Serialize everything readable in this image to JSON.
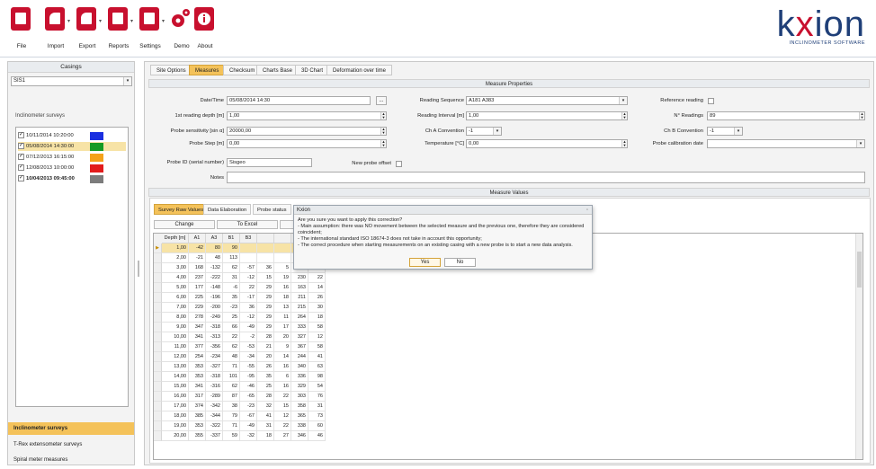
{
  "toolbar": {
    "buttons": [
      {
        "label": "File",
        "icon": "file-icon"
      },
      {
        "label": "Import",
        "icon": "import-icon"
      },
      {
        "label": "Export",
        "icon": "export-icon"
      },
      {
        "label": "Reports",
        "icon": "reports-icon"
      },
      {
        "label": "Settings",
        "icon": "settings-icon"
      },
      {
        "label": "Demo",
        "icon": "demo-icon"
      },
      {
        "label": "About",
        "icon": "about-icon"
      }
    ]
  },
  "logo": {
    "text_k": "k",
    "text_x": "x",
    "text_ion": "ion",
    "subtitle": "INCLINOMETER SOFTWARE"
  },
  "left": {
    "casings_title": "Casings",
    "casing_value": "SIS1",
    "surveys_title": "Inclinometer surveys",
    "surveys": [
      {
        "label": "10/11/2014 10:20:00",
        "color": "#1a2fe0",
        "checked": true
      },
      {
        "label": "05/08/2014 14:30:00",
        "color": "#159a24",
        "checked": true
      },
      {
        "label": "07/12/2013 16:15:00",
        "color": "#f4a21a",
        "checked": true
      },
      {
        "label": "12/08/2013 10:00:00",
        "color": "#e21b1b",
        "checked": true
      },
      {
        "label": "10/04/2013 09:45:00",
        "color": "#7c7c7c",
        "checked": true
      }
    ],
    "nav": [
      {
        "label": "Inclinometer surveys",
        "active": true
      },
      {
        "label": "T-Rex extensometer surveys",
        "active": false
      },
      {
        "label": "Spiral meter measures",
        "active": false
      }
    ]
  },
  "tabs": [
    "Site Options",
    "Measures",
    "Checksum",
    "Charts Base",
    "3D Chart",
    "Deformation over time"
  ],
  "measure_properties": {
    "title": "Measure Properties",
    "datetime_label": "Date/Time",
    "datetime_value": "05/08/2014 14:30",
    "datetime_btn": "...",
    "first_depth_label": "1st reading depth [m]",
    "first_depth_value": "1,00",
    "sensitivity_label": "Probe sensitivity [sin α]",
    "sensitivity_value": "20000,00",
    "step_label": "Probe Step [m]",
    "step_value": "0,00",
    "reading_seq_label": "Reading Sequence",
    "reading_seq_value": "A181 A383",
    "reading_interval_label": "Reading Interval [m]",
    "reading_interval_value": "1,00",
    "cha_label": "Ch A Convention",
    "cha_value": "-1",
    "temp_label": "Temperature [°C]",
    "temp_value": "0,00",
    "reference_label": "Reference reading",
    "nreadings_label": "N° Readings",
    "nreadings_value": "89",
    "chb_label": "Ch B Convention",
    "chb_value": "-1",
    "calib_label": "Probe calibration date",
    "probe_id_label": "Probe ID (serial number)",
    "probe_id_value": "Sisgeo",
    "new_offset_label": "New probe offset",
    "notes_label": "Notes"
  },
  "measure_values": {
    "title": "Measure Values",
    "inner_tabs": [
      "Survey Raw Values",
      "Data Elaboration",
      "Probe status"
    ],
    "change_btn": "Change",
    "excel_btn": "To Excel",
    "columns": [
      "Depth [m]",
      "A1 [digit]",
      "A3 [digit]",
      "B1 [digit]",
      "B3 [digit]",
      "",
      "",
      "",
      ""
    ],
    "rows": [
      [
        "1,00",
        "-42",
        "80",
        "90",
        "",
        "",
        "",
        "",
        ""
      ],
      [
        "2,00",
        "-21",
        "48",
        "113",
        "",
        "",
        "",
        "",
        ""
      ],
      [
        "3,00",
        "168",
        "-132",
        "62",
        "-57",
        "36",
        "5",
        "150",
        "60"
      ],
      [
        "4,00",
        "237",
        "-222",
        "31",
        "-12",
        "15",
        "19",
        "230",
        "22"
      ],
      [
        "5,00",
        "177",
        "-148",
        "-6",
        "22",
        "29",
        "16",
        "163",
        "14"
      ],
      [
        "6,00",
        "225",
        "-196",
        "35",
        "-17",
        "29",
        "18",
        "211",
        "26"
      ],
      [
        "7,00",
        "229",
        "-200",
        "-23",
        "36",
        "29",
        "13",
        "215",
        "30"
      ],
      [
        "8,00",
        "278",
        "-249",
        "25",
        "-12",
        "29",
        "11",
        "264",
        "18"
      ],
      [
        "9,00",
        "347",
        "-318",
        "66",
        "-49",
        "29",
        "17",
        "333",
        "58"
      ],
      [
        "10,00",
        "341",
        "-313",
        "22",
        "-2",
        "28",
        "20",
        "327",
        "12"
      ],
      [
        "11,00",
        "377",
        "-356",
        "62",
        "-53",
        "21",
        "9",
        "367",
        "58"
      ],
      [
        "12,00",
        "254",
        "-234",
        "48",
        "-34",
        "20",
        "14",
        "244",
        "41"
      ],
      [
        "13,00",
        "353",
        "-327",
        "71",
        "-55",
        "26",
        "16",
        "340",
        "63"
      ],
      [
        "14,00",
        "353",
        "-318",
        "101",
        "-95",
        "35",
        "6",
        "336",
        "98"
      ],
      [
        "15,00",
        "341",
        "-316",
        "62",
        "-46",
        "25",
        "16",
        "329",
        "54"
      ],
      [
        "16,00",
        "317",
        "-289",
        "87",
        "-65",
        "28",
        "22",
        "303",
        "76"
      ],
      [
        "17,00",
        "374",
        "-342",
        "38",
        "-23",
        "32",
        "15",
        "358",
        "31"
      ],
      [
        "18,00",
        "385",
        "-344",
        "79",
        "-67",
        "41",
        "12",
        "365",
        "73"
      ],
      [
        "19,00",
        "353",
        "-322",
        "71",
        "-49",
        "31",
        "22",
        "338",
        "60"
      ],
      [
        "20,00",
        "355",
        "-337",
        "59",
        "-32",
        "18",
        "27",
        "346",
        "46"
      ]
    ]
  },
  "dialog": {
    "title": "Kxion",
    "lines": [
      "Are you sure you want to apply this correction?",
      "- Main assumption: there was NO movement between the selected measure and the previous one, therefore they are considered",
      "coincident;",
      "- The international standard ISO 18674-3 does not take in account this opportunity;",
      "- The correct procedure when starting measurements on an existing casing with a new probe is to start a new data analysis."
    ],
    "yes": "Yes",
    "no": "No"
  }
}
